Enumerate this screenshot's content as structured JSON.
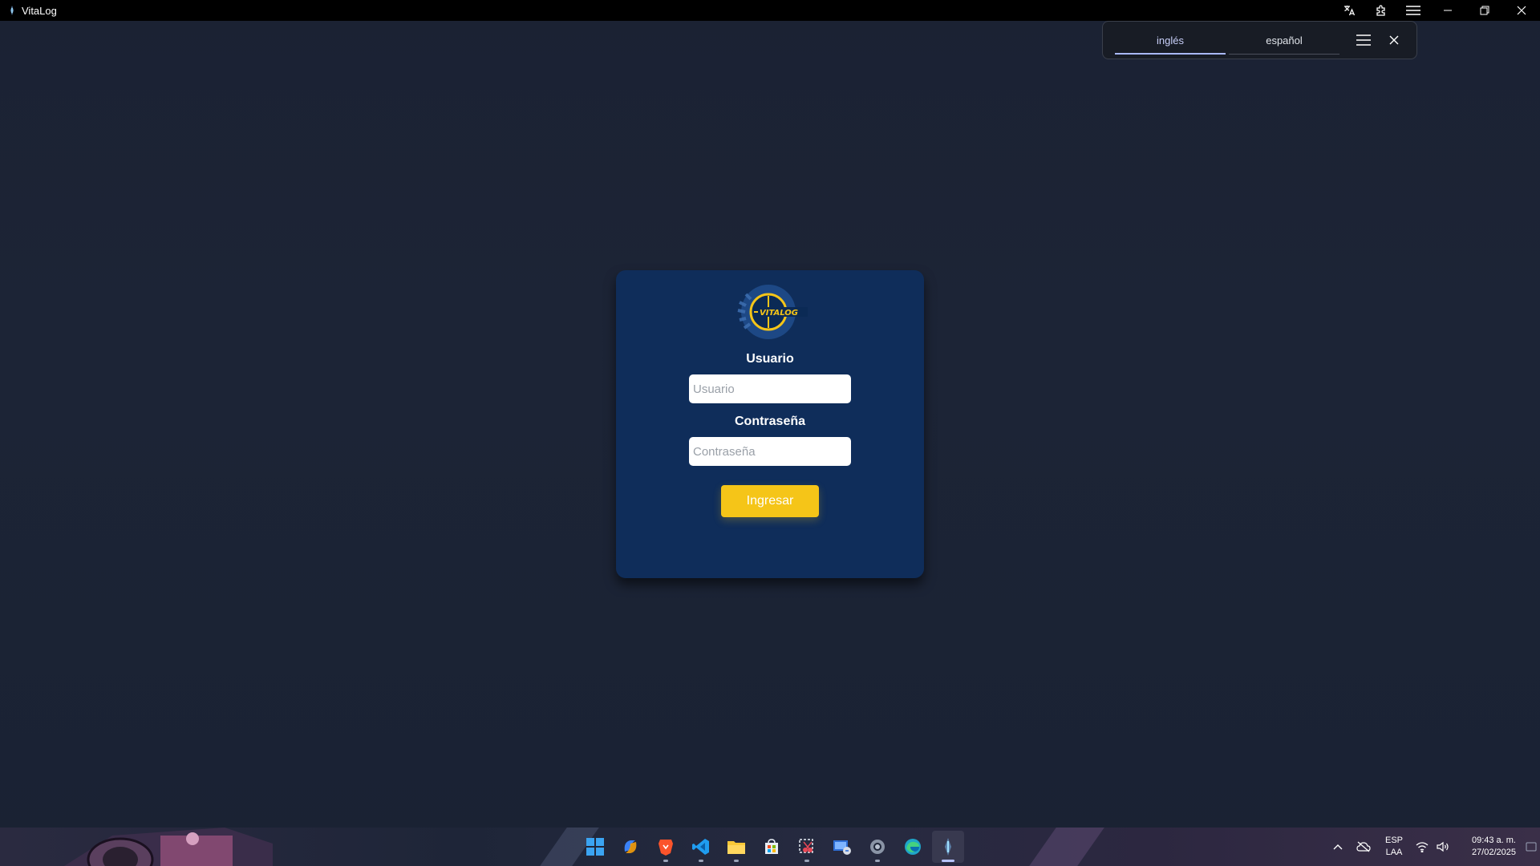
{
  "window": {
    "title": "VitaLog",
    "buttons": {
      "minimize": "minimize-icon",
      "restore": "restore-icon",
      "close": "close-icon"
    }
  },
  "titlebar_tools": [
    "translate-icon",
    "extensions-icon",
    "menu-icon"
  ],
  "translate_popup": {
    "tabs": [
      {
        "label": "inglés",
        "active": true
      },
      {
        "label": "español",
        "active": false
      }
    ]
  },
  "login": {
    "logo_alt": "VITALOG logo",
    "username_label": "Usuario",
    "username_placeholder": "Usuario",
    "username_value": "",
    "password_label": "Contraseña",
    "password_placeholder": "Contraseña",
    "password_value": "",
    "submit_label": "Ingresar"
  },
  "taskbar": {
    "apps": [
      "start",
      "copilot",
      "brave",
      "vscode",
      "file-explorer",
      "microsoft-store",
      "snipping-tool",
      "remote-desktop",
      "settings",
      "edge",
      "vitalog"
    ],
    "tray": {
      "lang_line1": "ESP",
      "lang_line2": "LAA",
      "time": "09:43 a. m.",
      "date": "27/02/2025"
    }
  },
  "colors": {
    "background": "#1c2436",
    "card": "#0f2d5a",
    "accent_button": "#f5c518",
    "active_tab": "#a9b8ff"
  }
}
